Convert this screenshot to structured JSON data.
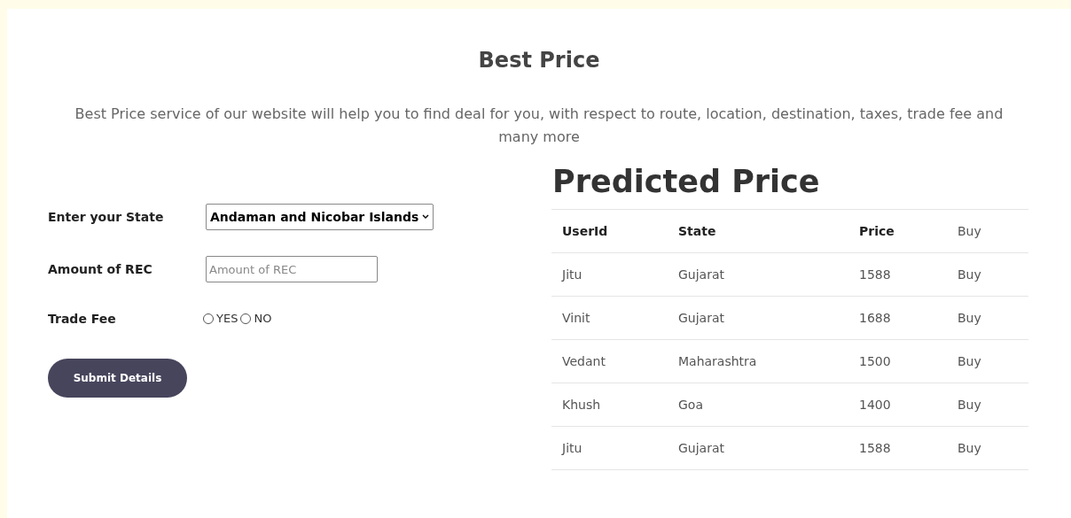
{
  "title": "Best Price",
  "description": "Best Price service of our website will help you to find deal for you, with respect to route, location, destination, taxes, trade fee and many more",
  "form": {
    "state_label": "Enter your State",
    "state_value": "Andaman and Nicobar Islands",
    "amount_label": "Amount of REC",
    "amount_placeholder": "Amount of REC",
    "trade_fee_label": "Trade Fee",
    "trade_fee_options": [
      {
        "label": "YES",
        "selected": false
      },
      {
        "label": "NO",
        "selected": false
      }
    ],
    "submit": "Submit Details"
  },
  "table": {
    "title": "Predicted Price",
    "columns": [
      {
        "label": "UserId",
        "bold": true
      },
      {
        "label": "State",
        "bold": true
      },
      {
        "label": "Price",
        "bold": true
      },
      {
        "label": "Buy",
        "bold": false
      }
    ],
    "rows": [
      [
        "Jitu",
        "Gujarat",
        "1588",
        "Buy"
      ],
      [
        "Vinit",
        "Gujarat",
        "1688",
        "Buy"
      ],
      [
        "Vedant",
        "Maharashtra",
        "1500",
        "Buy"
      ],
      [
        "Khush",
        "Goa",
        "1400",
        "Buy"
      ],
      [
        "Jitu",
        "Gujarat",
        "1588",
        "Buy"
      ]
    ]
  }
}
